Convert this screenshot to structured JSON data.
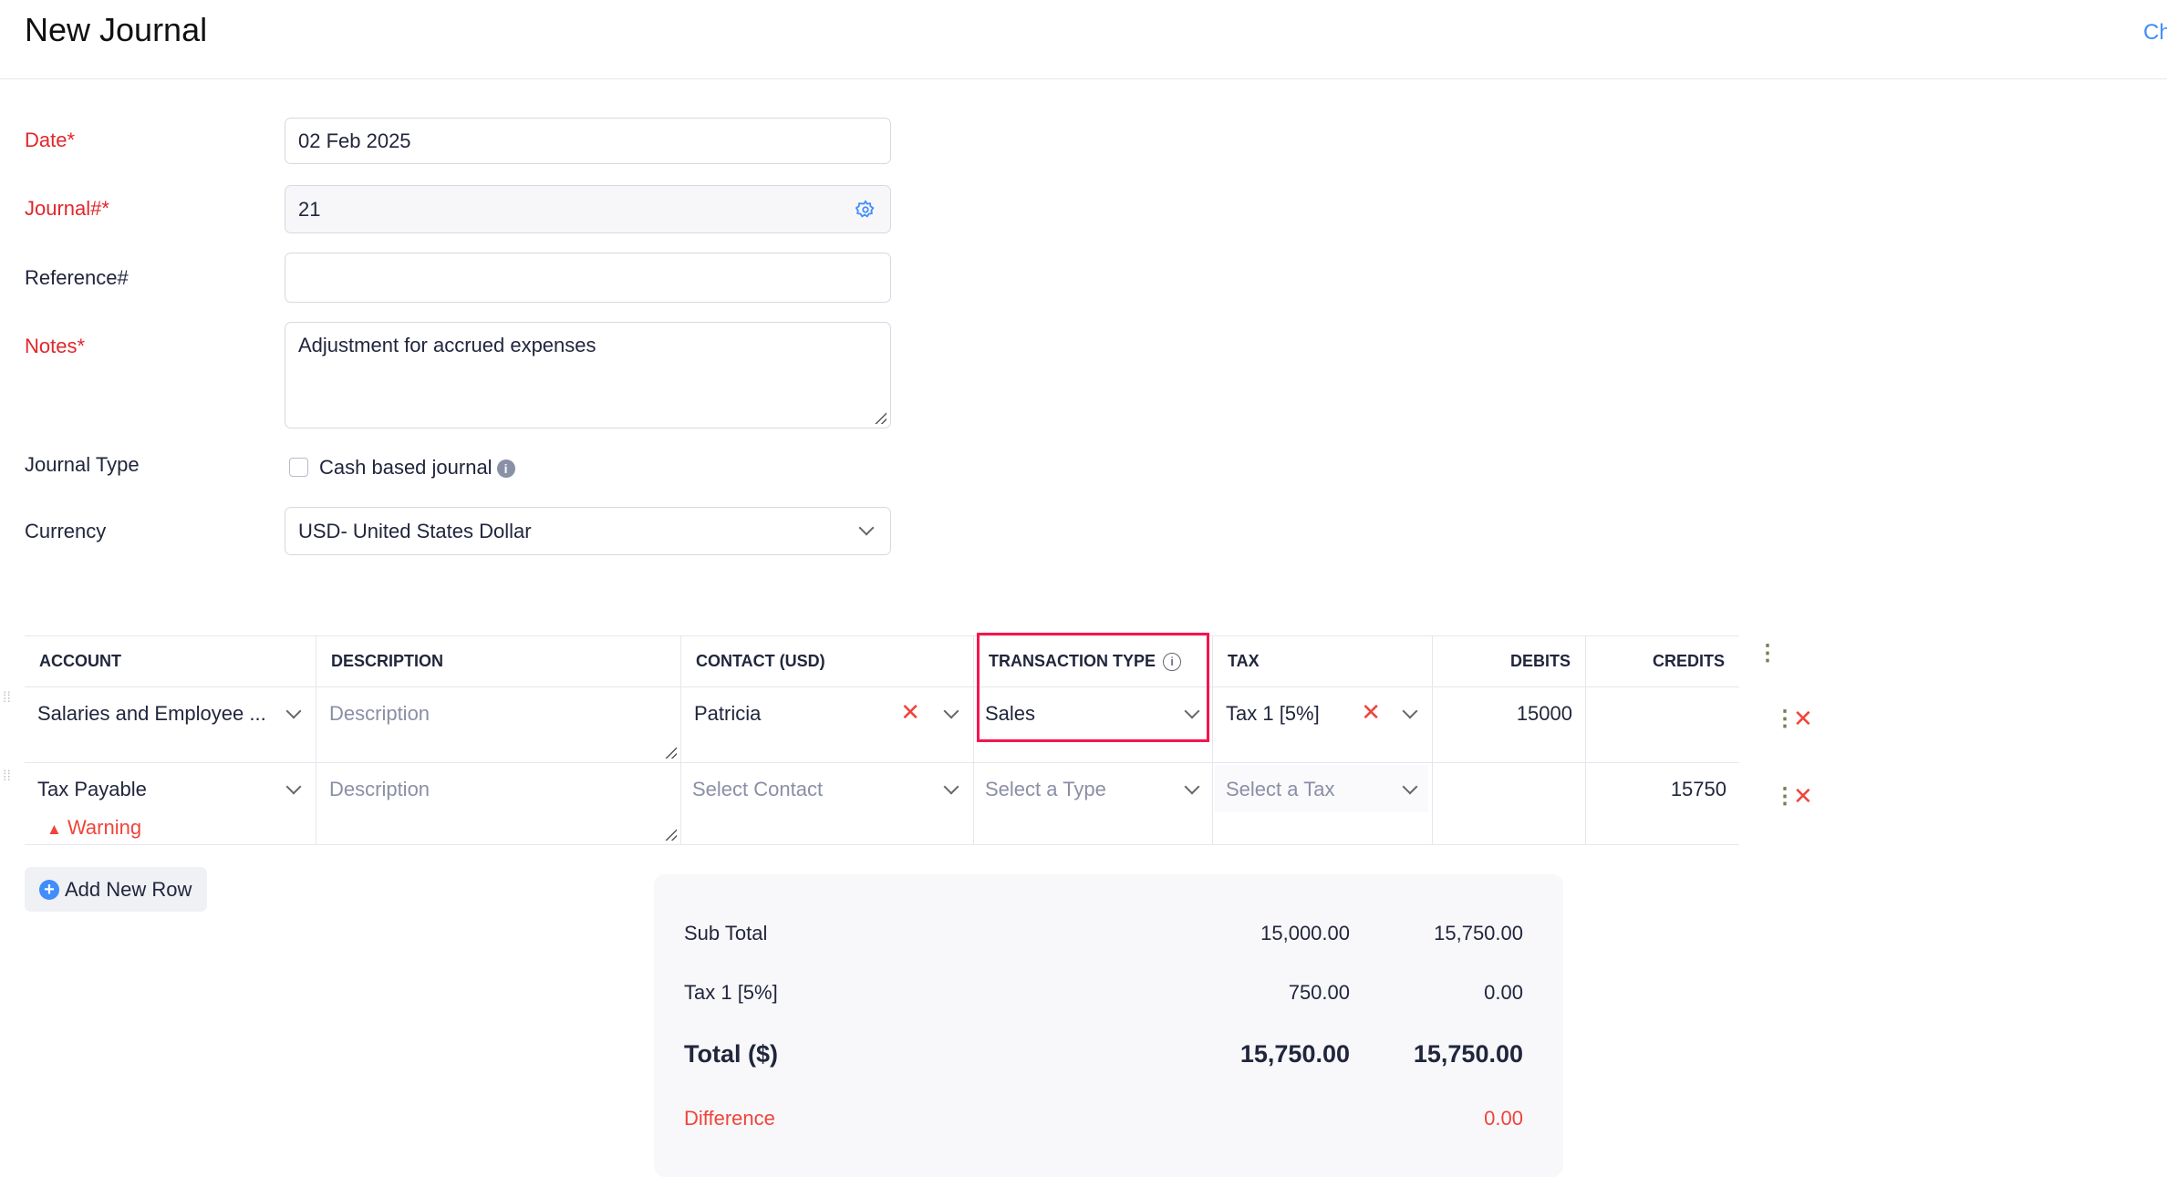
{
  "header": {
    "title": "New Journal",
    "top_link": "Ch"
  },
  "form": {
    "date": {
      "label": "Date*",
      "value": "02 Feb 2025"
    },
    "journal": {
      "label": "Journal#*",
      "value": "21"
    },
    "reference": {
      "label": "Reference#",
      "value": ""
    },
    "notes": {
      "label": "Notes*",
      "value": "Adjustment for accrued expenses"
    },
    "journal_type": {
      "label": "Journal Type",
      "checkbox_label": "Cash based journal",
      "checked": false
    },
    "currency": {
      "label": "Currency",
      "value": "USD- United States Dollar"
    }
  },
  "table": {
    "headers": [
      "ACCOUNT",
      "DESCRIPTION",
      "CONTACT (USD)",
      "TRANSACTION TYPE",
      "TAX",
      "DEBITS",
      "CREDITS"
    ],
    "rows": [
      {
        "account": "Salaries and Employee ...",
        "description": "Description",
        "contact": "Patricia",
        "transaction_type": "Sales",
        "tax": "Tax 1 [5%]",
        "debits": "15000",
        "credits": ""
      },
      {
        "account": "Tax Payable",
        "warning": "Warning",
        "description": "Description",
        "contact": "Select Contact",
        "transaction_type": "Select a Type",
        "tax": "Select a Tax",
        "debits": "",
        "credits": "15750"
      }
    ],
    "add_row_label": "Add New Row"
  },
  "summary": {
    "sub_total": {
      "label": "Sub Total",
      "debit": "15,000.00",
      "credit": "15,750.00"
    },
    "tax": {
      "label": "Tax 1 [5%]",
      "debit": "750.00",
      "credit": "0.00"
    },
    "total": {
      "label": "Total ($)",
      "debit": "15,750.00",
      "credit": "15,750.00"
    },
    "difference": {
      "label": "Difference",
      "value": "0.00"
    }
  },
  "colors": {
    "accent": "#408dfb",
    "required": "#e3262b",
    "highlight": "#f5154d"
  }
}
